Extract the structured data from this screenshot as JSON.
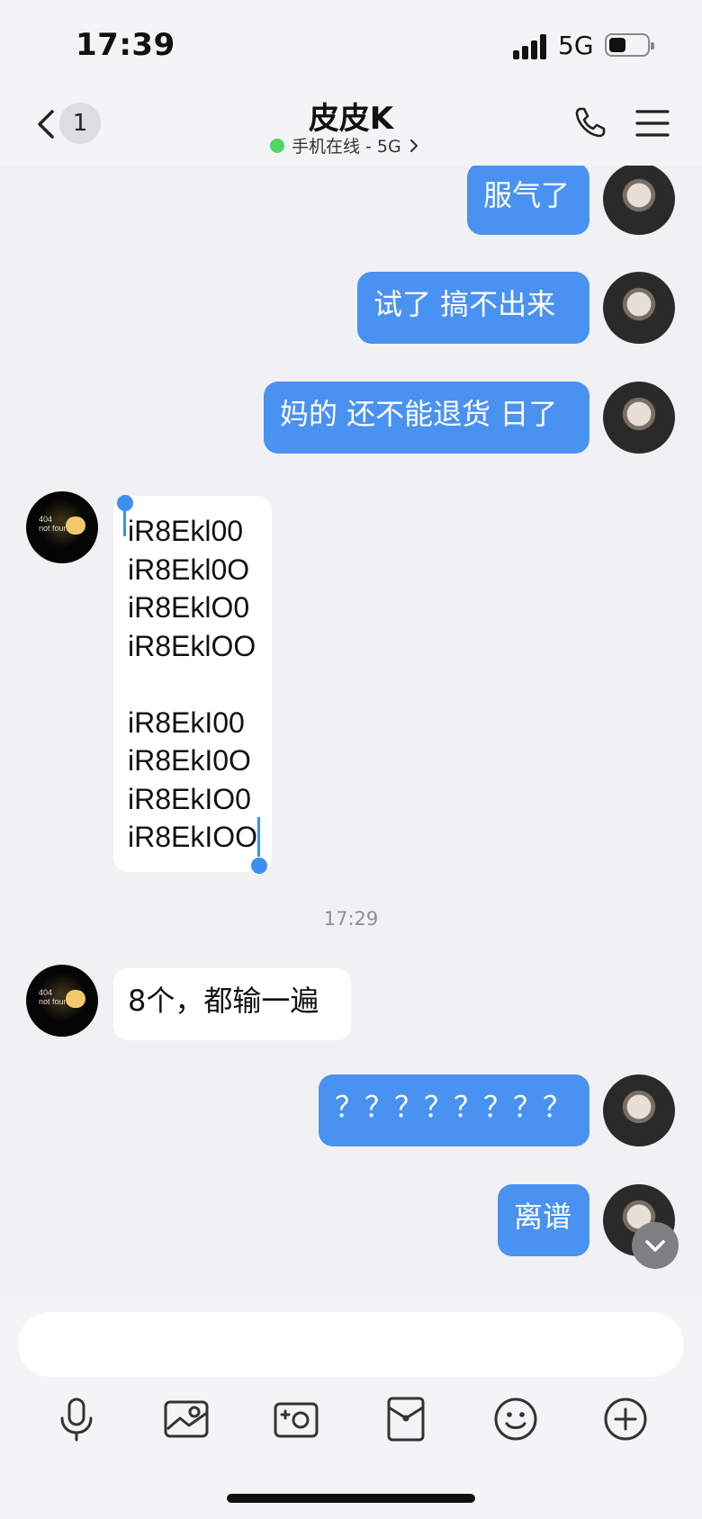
{
  "status_bar": {
    "time": "17:39",
    "network": "5G",
    "battery_level": 0.45
  },
  "header": {
    "back_badge": "1",
    "title": "皮皮K",
    "subtitle": "手机在线 - 5G",
    "icons": [
      "chevron-left-icon",
      "phone-icon",
      "menu-icon",
      "chevron-right-icon"
    ]
  },
  "messages": [
    {
      "dir": "out",
      "text": "服气了"
    },
    {
      "dir": "out",
      "text": "试了  搞不出来"
    },
    {
      "dir": "out",
      "text": "妈的 还不能退货 日了"
    },
    {
      "dir": "in",
      "lines": [
        "iR8Ekl00",
        "iR8Ekl0O",
        "iR8EklO0",
        "iR8EklOO",
        "",
        "iR8EkI00",
        "iR8EkI0O",
        "iR8EkIO0",
        "iR8EkIOO"
      ]
    },
    {
      "dir": "time",
      "text": "17:29"
    },
    {
      "dir": "in",
      "text": "8个，都输一遍"
    },
    {
      "dir": "out",
      "text": "？？？？？？？？"
    },
    {
      "dir": "out",
      "text": "离谱"
    }
  ],
  "avatar_dark": {
    "line1": "404",
    "line2": "not found"
  },
  "composer": {
    "placeholder": "",
    "value": ""
  },
  "toolbar": [
    "microphone-icon",
    "image-icon",
    "camera-icon",
    "red-packet-icon",
    "emoji-icon",
    "plus-icon"
  ],
  "colors": {
    "outgoing": "#4a92f1",
    "incoming": "#ffffff",
    "online": "#4cd964",
    "background": "#f1f1f3"
  }
}
